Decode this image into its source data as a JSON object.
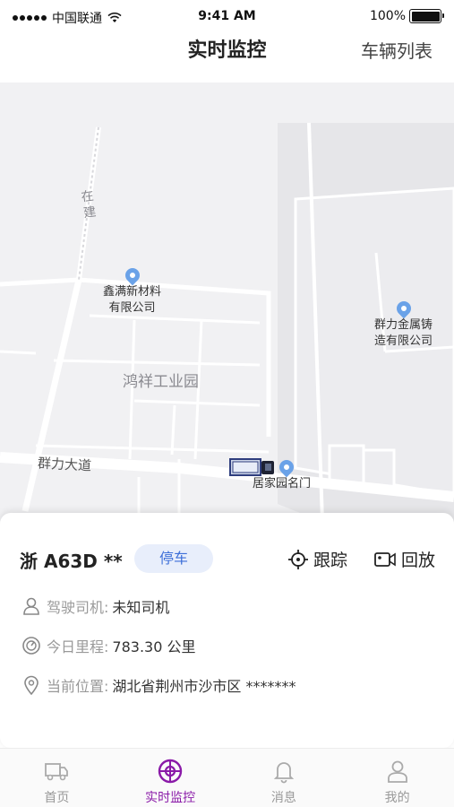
{
  "status_bar": {
    "carrier": "中国联通",
    "time": "9:41 AM",
    "battery": "100%",
    "battery_level": 1.0
  },
  "nav": {
    "title": "实时监控",
    "right_label": "车辆列表"
  },
  "map": {
    "pois": [
      {
        "name_line1": "鑫满新材料",
        "name_line2": "有限公司",
        "icon": "location-pin-icon"
      },
      {
        "name_line1": "群力金属铸",
        "name_line2": "造有限公司",
        "icon": "location-pin-icon"
      },
      {
        "name_line1": "居家园名门",
        "icon": "lock-pin-icon"
      }
    ],
    "labels": {
      "park": "鸿祥工业园",
      "road_main": "群力大道",
      "road_vertical": "在建"
    },
    "vehicle_icon": "truck-marker-icon"
  },
  "vehicle": {
    "plate": "浙 A63D **",
    "status": "停车",
    "track_label": "跟踪",
    "replay_label": "回放",
    "driver_label": "驾驶司机:",
    "driver_value": "未知司机",
    "mileage_label": "今日里程:",
    "mileage_value": "783.30 公里",
    "location_label": "当前位置:",
    "location_value": "湖北省荆州市沙市区 *******"
  },
  "tabs": [
    {
      "label": "首页",
      "icon": "truck-icon",
      "active": false
    },
    {
      "label": "实时监控",
      "icon": "target-icon",
      "active": true
    },
    {
      "label": "消息",
      "icon": "bell-icon",
      "active": false
    },
    {
      "label": "我的",
      "icon": "user-icon",
      "active": false
    }
  ],
  "colors": {
    "accent": "#8a1aa8",
    "badge_bg": "#e8eefb",
    "badge_text": "#3d6fd8",
    "map_bg": "#f1f1f3"
  }
}
